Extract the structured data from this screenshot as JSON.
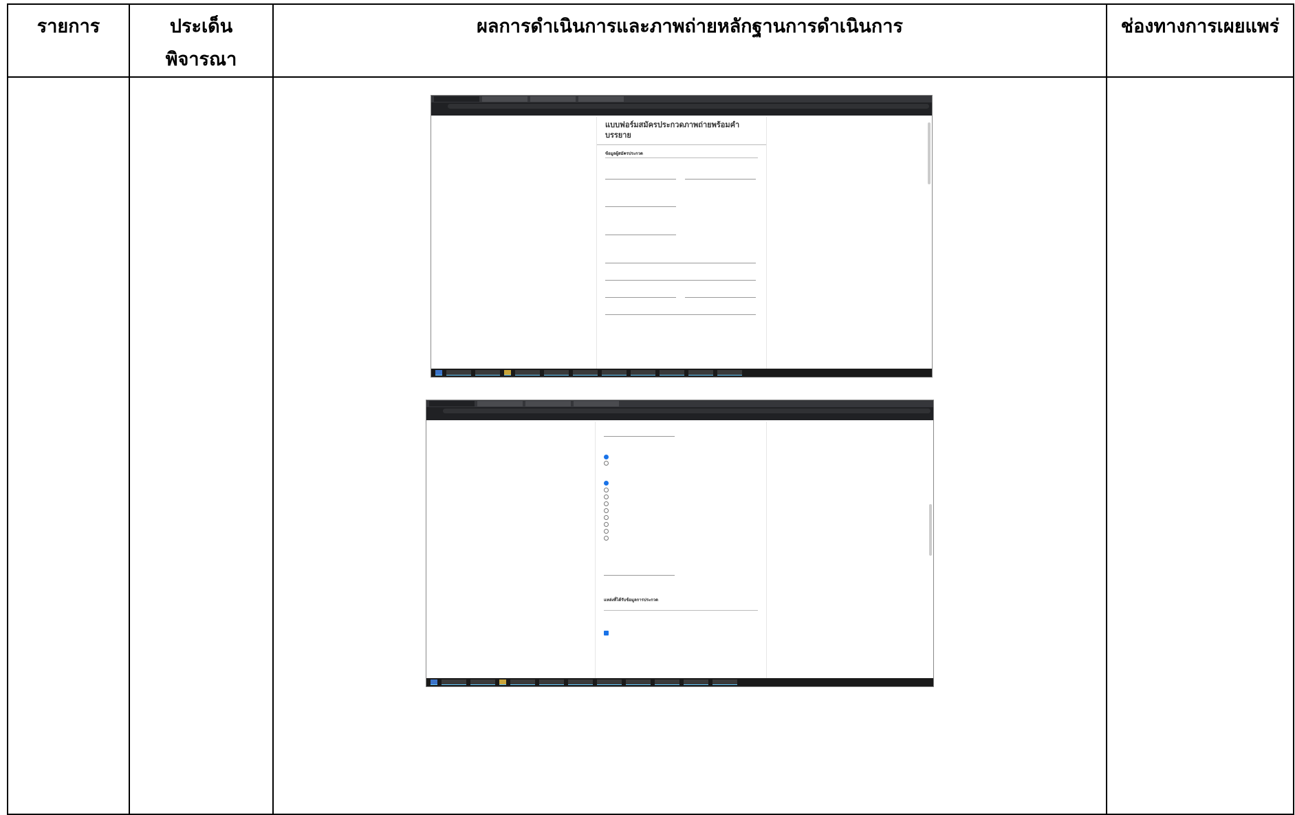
{
  "table": {
    "headers": [
      "รายการ",
      "ประเด็นพิจารณา",
      "ผลการดำเนินการและภาพถ่ายหลักฐานการดำเนินการ",
      "ช่องทางการเผยแพร่"
    ]
  },
  "screenshot1": {
    "form_title": "แบบฟอร์มสมัครประกวดภาพถ่ายพร้อมคำบรรยาย",
    "section": "ข้อมูลผู้สมัครประกวด"
  },
  "screenshot2": {
    "section": "แหล่งที่ได้รับข้อมูลการประกวด"
  }
}
